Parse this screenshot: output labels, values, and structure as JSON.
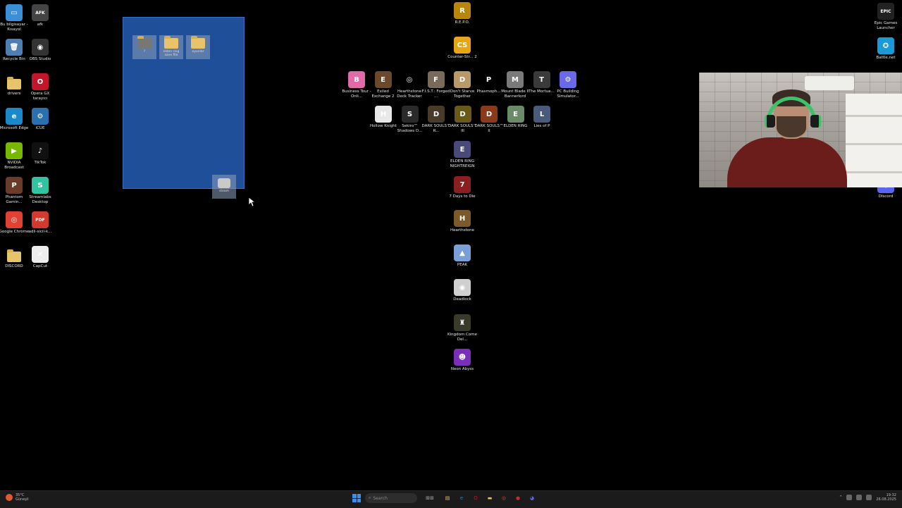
{
  "desktop": {
    "left_icons": [
      {
        "label": "Bu bilgisayar - Kısayol",
        "glyph": "▭",
        "color": "#3a8fd6"
      },
      {
        "label": "afk",
        "glyph": "AFK",
        "color": "#444"
      },
      {
        "label": "Recycle Bin",
        "glyph": "🗑",
        "color": "#4d7fb3"
      },
      {
        "label": "OBS Studio",
        "glyph": "◉",
        "color": "#333"
      },
      {
        "label": "drivers",
        "glyph": "",
        "color": "#e7c36a"
      },
      {
        "label": "Opera GX tarayıcı",
        "glyph": "O",
        "color": "#c4162a"
      },
      {
        "label": "Microsoft Edge",
        "glyph": "e",
        "color": "#1a88c9"
      },
      {
        "label": "iCUE",
        "glyph": "⚙",
        "color": "#2a6fae"
      },
      {
        "label": "NVIDIA Broadcast",
        "glyph": "▶",
        "color": "#76b900"
      },
      {
        "label": "TikTok",
        "glyph": "♪",
        "color": "#111"
      },
      {
        "label": "Phantom Gamin...",
        "glyph": "P",
        "color": "#6a3b2a"
      },
      {
        "label": "Streamlabs Desktop",
        "glyph": "S",
        "color": "#31c3a2"
      },
      {
        "label": "Google Chrome",
        "glyph": "◎",
        "color": "#e04133"
      },
      {
        "label": "adli-sicil-k...",
        "glyph": "PDF",
        "color": "#d23a2f"
      },
      {
        "label": "DISCORD",
        "glyph": "",
        "color": "#e7c36a"
      },
      {
        "label": "CapCut",
        "glyph": "✕",
        "color": "#eee"
      }
    ],
    "selection_items": [
      {
        "label": "?",
        "type": "folder-dark"
      },
      {
        "label": "elden ring save file",
        "type": "folder"
      },
      {
        "label": "oyunlar",
        "type": "folder"
      },
      {
        "label": "steam",
        "type": "app"
      }
    ],
    "center_column": [
      {
        "label": "R.E.P.O.",
        "glyph": "R",
        "color": "#b8860b"
      },
      {
        "label": "Counter-Str... 2",
        "glyph": "CS",
        "color": "#e8a617"
      },
      {
        "label": "ELDEN RING NIGHTREIGN",
        "glyph": "E",
        "color": "#4a4a7a"
      },
      {
        "label": "7 Days to Die",
        "glyph": "7",
        "color": "#8a1f1f"
      },
      {
        "label": "Hearthstone",
        "glyph": "H",
        "color": "#7a5a2a"
      },
      {
        "label": "PEAK",
        "glyph": "▲",
        "color": "#7aa0d8"
      },
      {
        "label": "Deadlock",
        "glyph": "◉",
        "color": "#cfcfcf"
      },
      {
        "label": "Kingdom Come Del...",
        "glyph": "♜",
        "color": "#3a3a2a"
      },
      {
        "label": "Neon Abyss",
        "glyph": "☻",
        "color": "#7a2fb8"
      }
    ],
    "game_row_1": [
      {
        "label": "Business Tour - Onli...",
        "glyph": "B",
        "color": "#e36aa8"
      },
      {
        "label": "Exiled Exchange 2",
        "glyph": "E",
        "color": "#6a4a2a"
      },
      {
        "label": "Hearthstone Deck Tracker",
        "glyph": "◎",
        "color": "#000"
      },
      {
        "label": "F.I.S.T.: Forged ...",
        "glyph": "F",
        "color": "#7a6a5a"
      },
      {
        "label": "Don't Starve Together",
        "glyph": "D",
        "color": "#b89a6a"
      },
      {
        "label": "Phasmoph...",
        "glyph": "P",
        "color": "#000"
      },
      {
        "label": "Mount Blade II Bannerlord",
        "glyph": "M",
        "color": "#7a7a7a"
      },
      {
        "label": "The Mortua...",
        "glyph": "T",
        "color": "#3a3a3a"
      },
      {
        "label": "PC Building Simulator...",
        "glyph": "⚙",
        "color": "#6a6ae8"
      }
    ],
    "game_row_2": [
      {
        "label": "Hollow Knight",
        "glyph": "H",
        "color": "#e8e8e8"
      },
      {
        "label": "Sekiro™ Shadows D...",
        "glyph": "S",
        "color": "#2a2a2a"
      },
      {
        "label": "DARK SOULS™ R...",
        "glyph": "D",
        "color": "#4a3a2a"
      },
      {
        "label": "DARK SOULS™ III",
        "glyph": "D",
        "color": "#6a5a1a"
      },
      {
        "label": "DARK SOULS™ II",
        "glyph": "D",
        "color": "#8a3a1a"
      },
      {
        "label": "ELDEN RING",
        "glyph": "E",
        "color": "#6a8a6a"
      },
      {
        "label": "Lies of P",
        "glyph": "L",
        "color": "#4a5a7a"
      }
    ],
    "right_icons": [
      {
        "label": "Epic Games Launcher",
        "glyph": "EPIC",
        "color": "#222"
      },
      {
        "label": "Battle.net",
        "glyph": "✪",
        "color": "#1a9ad6"
      },
      {
        "label": "Discord",
        "glyph": "◕",
        "color": "#5865f2"
      }
    ]
  },
  "taskbar": {
    "weather_temp": "35°C",
    "weather_desc": "Güneşli",
    "search_placeholder": "Search",
    "apps": [
      {
        "name": "file-explorer",
        "glyph": "▤",
        "color": "#e7c36a"
      },
      {
        "name": "edge",
        "glyph": "e",
        "color": "#1a88c9"
      },
      {
        "name": "opera",
        "glyph": "O",
        "color": "#c4162a"
      },
      {
        "name": "folder",
        "glyph": "▬",
        "color": "#e7c36a"
      },
      {
        "name": "chrome",
        "glyph": "◎",
        "color": "#e04133"
      },
      {
        "name": "app-red",
        "glyph": "●",
        "color": "#c42a2a"
      },
      {
        "name": "discord",
        "glyph": "◕",
        "color": "#5865f2"
      }
    ],
    "time": "19:32",
    "date": "26.08.2025"
  }
}
